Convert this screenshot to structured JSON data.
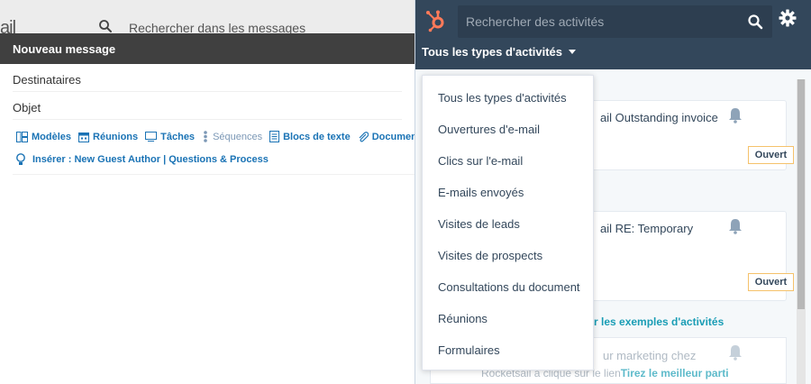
{
  "gmail": {
    "logo_text": "ail",
    "search_placeholder": "Rechercher dans les messages"
  },
  "compose": {
    "title": "Nouveau message",
    "recipients_label": "Destinataires",
    "subject_label": "Objet",
    "toolbar": [
      {
        "label": "Modèles",
        "icon": "template-icon"
      },
      {
        "label": "Réunions",
        "icon": "calendar-icon"
      },
      {
        "label": "Tâches",
        "icon": "task-icon"
      },
      {
        "label": "Séquences",
        "icon": "sequence-icon"
      },
      {
        "label": "Blocs de texte",
        "icon": "snippet-icon"
      },
      {
        "label": "Document",
        "icon": "paperclip-icon"
      }
    ],
    "insert_label": "Insérer : New Guest Author | Questions & Process"
  },
  "hubspot": {
    "search_placeholder": "Rechercher des activités",
    "filter_label": "Tous les types d'activités",
    "dropdown_items": [
      "Tous les types d'activités",
      "Ouvertures d'e-mail",
      "Clics sur l'e-mail",
      "E-mails envoyés",
      "Visites de leads",
      "Visites de prospects",
      "Consultations du document",
      "Réunions",
      "Formulaires"
    ],
    "cards": [
      {
        "title": "ail Outstanding invoice",
        "badge": "Ouvert"
      },
      {
        "title": "ail RE: Temporary",
        "badge": "Ouvert"
      }
    ],
    "examples_link": "r les exemples d'activités",
    "example_card": {
      "title": "ur marketing chez",
      "line_prefix": "Rocketsail a cliqué sur le lien",
      "line_link": "Tirez le meilleur parti"
    },
    "colors": {
      "header": "#33475b",
      "accent": "#ff7a59",
      "link": "#1a9db5"
    }
  }
}
